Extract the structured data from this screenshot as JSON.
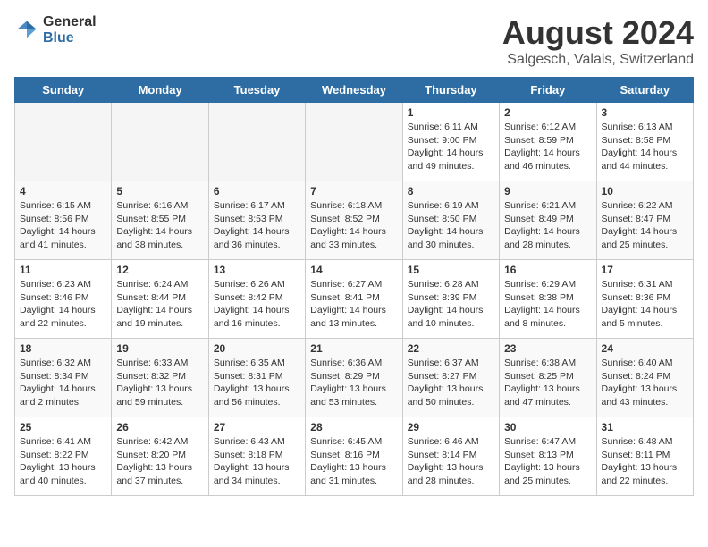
{
  "logo": {
    "general": "General",
    "blue": "Blue"
  },
  "title": "August 2024",
  "subtitle": "Salgesch, Valais, Switzerland",
  "weekdays": [
    "Sunday",
    "Monday",
    "Tuesday",
    "Wednesday",
    "Thursday",
    "Friday",
    "Saturday"
  ],
  "weeks": [
    [
      {
        "day": "",
        "info": ""
      },
      {
        "day": "",
        "info": ""
      },
      {
        "day": "",
        "info": ""
      },
      {
        "day": "",
        "info": ""
      },
      {
        "day": "1",
        "info": "Sunrise: 6:11 AM\nSunset: 9:00 PM\nDaylight: 14 hours and 49 minutes."
      },
      {
        "day": "2",
        "info": "Sunrise: 6:12 AM\nSunset: 8:59 PM\nDaylight: 14 hours and 46 minutes."
      },
      {
        "day": "3",
        "info": "Sunrise: 6:13 AM\nSunset: 8:58 PM\nDaylight: 14 hours and 44 minutes."
      }
    ],
    [
      {
        "day": "4",
        "info": "Sunrise: 6:15 AM\nSunset: 8:56 PM\nDaylight: 14 hours and 41 minutes."
      },
      {
        "day": "5",
        "info": "Sunrise: 6:16 AM\nSunset: 8:55 PM\nDaylight: 14 hours and 38 minutes."
      },
      {
        "day": "6",
        "info": "Sunrise: 6:17 AM\nSunset: 8:53 PM\nDaylight: 14 hours and 36 minutes."
      },
      {
        "day": "7",
        "info": "Sunrise: 6:18 AM\nSunset: 8:52 PM\nDaylight: 14 hours and 33 minutes."
      },
      {
        "day": "8",
        "info": "Sunrise: 6:19 AM\nSunset: 8:50 PM\nDaylight: 14 hours and 30 minutes."
      },
      {
        "day": "9",
        "info": "Sunrise: 6:21 AM\nSunset: 8:49 PM\nDaylight: 14 hours and 28 minutes."
      },
      {
        "day": "10",
        "info": "Sunrise: 6:22 AM\nSunset: 8:47 PM\nDaylight: 14 hours and 25 minutes."
      }
    ],
    [
      {
        "day": "11",
        "info": "Sunrise: 6:23 AM\nSunset: 8:46 PM\nDaylight: 14 hours and 22 minutes."
      },
      {
        "day": "12",
        "info": "Sunrise: 6:24 AM\nSunset: 8:44 PM\nDaylight: 14 hours and 19 minutes."
      },
      {
        "day": "13",
        "info": "Sunrise: 6:26 AM\nSunset: 8:42 PM\nDaylight: 14 hours and 16 minutes."
      },
      {
        "day": "14",
        "info": "Sunrise: 6:27 AM\nSunset: 8:41 PM\nDaylight: 14 hours and 13 minutes."
      },
      {
        "day": "15",
        "info": "Sunrise: 6:28 AM\nSunset: 8:39 PM\nDaylight: 14 hours and 10 minutes."
      },
      {
        "day": "16",
        "info": "Sunrise: 6:29 AM\nSunset: 8:38 PM\nDaylight: 14 hours and 8 minutes."
      },
      {
        "day": "17",
        "info": "Sunrise: 6:31 AM\nSunset: 8:36 PM\nDaylight: 14 hours and 5 minutes."
      }
    ],
    [
      {
        "day": "18",
        "info": "Sunrise: 6:32 AM\nSunset: 8:34 PM\nDaylight: 14 hours and 2 minutes."
      },
      {
        "day": "19",
        "info": "Sunrise: 6:33 AM\nSunset: 8:32 PM\nDaylight: 13 hours and 59 minutes."
      },
      {
        "day": "20",
        "info": "Sunrise: 6:35 AM\nSunset: 8:31 PM\nDaylight: 13 hours and 56 minutes."
      },
      {
        "day": "21",
        "info": "Sunrise: 6:36 AM\nSunset: 8:29 PM\nDaylight: 13 hours and 53 minutes."
      },
      {
        "day": "22",
        "info": "Sunrise: 6:37 AM\nSunset: 8:27 PM\nDaylight: 13 hours and 50 minutes."
      },
      {
        "day": "23",
        "info": "Sunrise: 6:38 AM\nSunset: 8:25 PM\nDaylight: 13 hours and 47 minutes."
      },
      {
        "day": "24",
        "info": "Sunrise: 6:40 AM\nSunset: 8:24 PM\nDaylight: 13 hours and 43 minutes."
      }
    ],
    [
      {
        "day": "25",
        "info": "Sunrise: 6:41 AM\nSunset: 8:22 PM\nDaylight: 13 hours and 40 minutes."
      },
      {
        "day": "26",
        "info": "Sunrise: 6:42 AM\nSunset: 8:20 PM\nDaylight: 13 hours and 37 minutes."
      },
      {
        "day": "27",
        "info": "Sunrise: 6:43 AM\nSunset: 8:18 PM\nDaylight: 13 hours and 34 minutes."
      },
      {
        "day": "28",
        "info": "Sunrise: 6:45 AM\nSunset: 8:16 PM\nDaylight: 13 hours and 31 minutes."
      },
      {
        "day": "29",
        "info": "Sunrise: 6:46 AM\nSunset: 8:14 PM\nDaylight: 13 hours and 28 minutes."
      },
      {
        "day": "30",
        "info": "Sunrise: 6:47 AM\nSunset: 8:13 PM\nDaylight: 13 hours and 25 minutes."
      },
      {
        "day": "31",
        "info": "Sunrise: 6:48 AM\nSunset: 8:11 PM\nDaylight: 13 hours and 22 minutes."
      }
    ]
  ]
}
